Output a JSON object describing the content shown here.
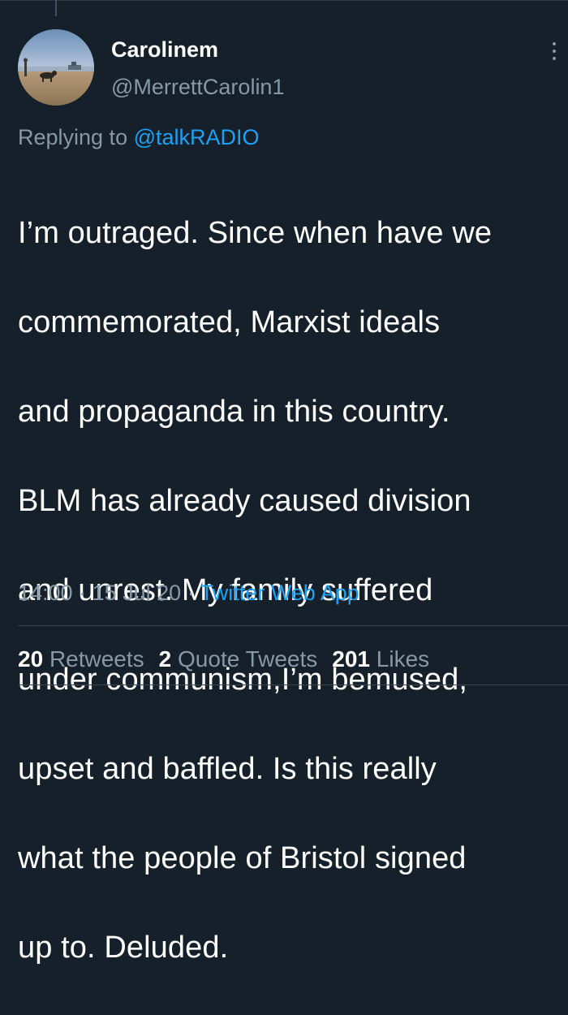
{
  "tweet": {
    "display_name": "Carolinem",
    "handle": "@MerrettCarolin1",
    "reply": {
      "prefix": "Replying to",
      "mention": "@talkRADIO"
    },
    "text_lines": [
      "I’m outraged. Since when have we",
      "commemorated, Marxist  ideals",
      "and propaganda in this country.",
      "BLM has already caused division",
      "and unrest. My family suffered",
      "under communism,I’m bemused,",
      "upset and baffled. Is this really",
      "what the people of  Bristol signed",
      "up to. Deluded."
    ],
    "time": "14:00",
    "date": "15 Jul 20",
    "separator": "·",
    "source": "Twitter Web App"
  },
  "stats": {
    "retweets_count": "20",
    "retweets_label": "Retweets",
    "quotes_count": "2",
    "quotes_label": "Quote Tweets",
    "likes_count": "201",
    "likes_label": "Likes"
  },
  "icons": {
    "more": "more-vertical-icon"
  },
  "colors": {
    "background": "#15202b",
    "accent": "#1da1f2",
    "secondary_text": "#8899a6",
    "divider": "#38444d"
  }
}
